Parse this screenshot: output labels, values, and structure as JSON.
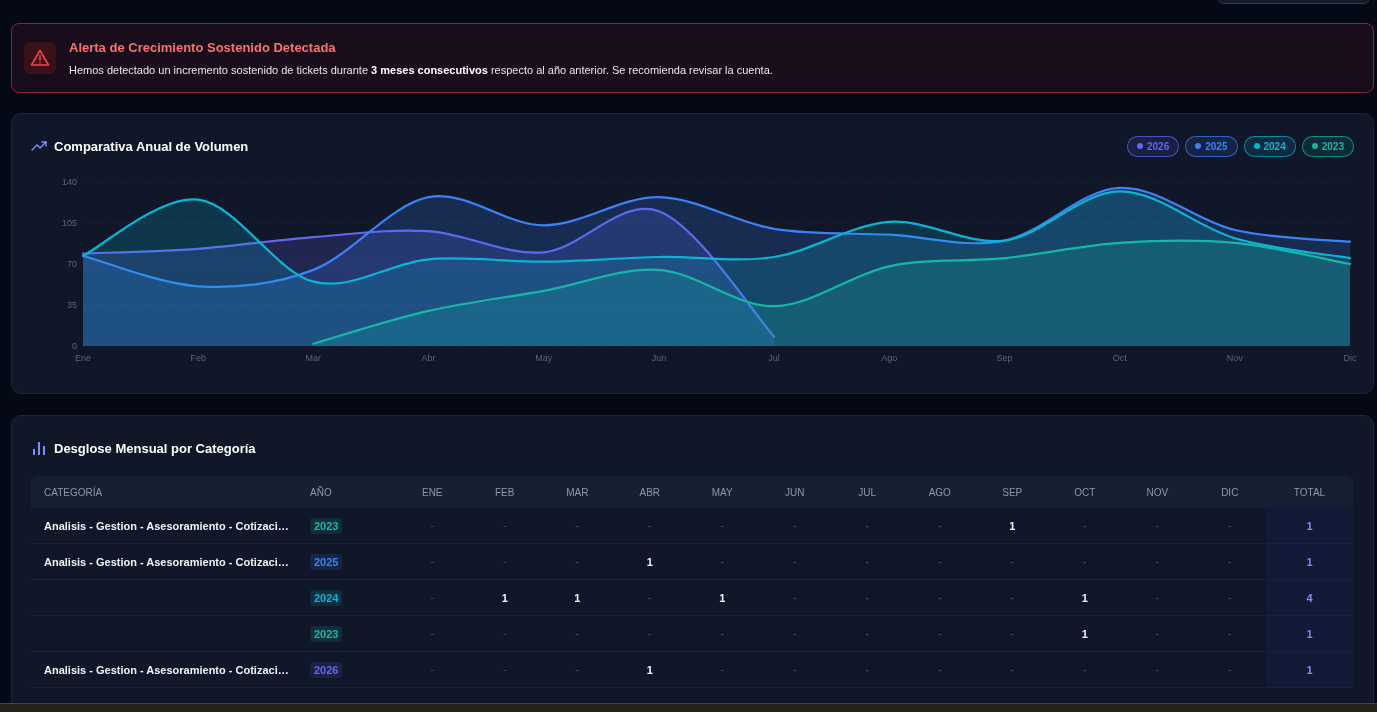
{
  "alert": {
    "title": "Alerta de Crecimiento Sostenido Detectada",
    "message": "Hemos detectado un incremento sostenido de tickets durante **3 meses consecutivos** respecto al año anterior. Se recomienda revisar la cuenta."
  },
  "volume_chart": {
    "title": "Comparativa Anual de Volumen",
    "chart_data": {
      "type": "area",
      "categories": [
        "Ene",
        "Feb",
        "Mar",
        "Abr",
        "May",
        "Jun",
        "Jul",
        "Ago",
        "Sep",
        "Oct",
        "Nov",
        "Dic"
      ],
      "series": [
        {
          "name": "2026",
          "color": "#6366f1",
          "values": [
            79,
            83,
            93,
            98,
            80,
            115,
            8,
            null,
            null,
            null,
            null,
            null
          ]
        },
        {
          "name": "2025",
          "color": "#3b82f6",
          "values": [
            77,
            51,
            65,
            127,
            103,
            127,
            100,
            95,
            90,
            135,
            99,
            89
          ]
        },
        {
          "name": "2024",
          "color": "#06b6d4",
          "values": [
            77,
            125,
            55,
            74,
            72,
            76,
            76,
            106,
            90,
            132,
            92,
            75
          ]
        },
        {
          "name": "2023",
          "color": "#14b8a6",
          "values": [
            null,
            null,
            2,
            30,
            47,
            65,
            34,
            68,
            75,
            88,
            88,
            70
          ]
        }
      ],
      "ylim": [
        0,
        140
      ],
      "yticks": [
        0,
        35,
        70,
        105,
        140
      ]
    }
  },
  "breakdown": {
    "title": "Desglose Mensual por Categoría",
    "table": {
      "columns": [
        "CATEGORÍA",
        "AÑO",
        "ENE",
        "FEB",
        "MAR",
        "ABR",
        "MAY",
        "JUN",
        "JUL",
        "AGO",
        "SEP",
        "OCT",
        "NOV",
        "DIC",
        "TOTAL"
      ],
      "rows": [
        {
          "category": "Analisis - Gestion - Asesoramiento - Cotizaci…",
          "year": "2023",
          "color": "#14b8a6",
          "months": [
            "-",
            "-",
            "-",
            "-",
            "-",
            "-",
            "-",
            "-",
            "1",
            "-",
            "-",
            "-"
          ],
          "total": "1"
        },
        {
          "category": "Analisis - Gestion - Asesoramiento - Cotizaci…",
          "year": "2025",
          "color": "#3b82f6",
          "months": [
            "-",
            "-",
            "-",
            "1",
            "-",
            "-",
            "-",
            "-",
            "-",
            "-",
            "-",
            "-"
          ],
          "total": "1"
        },
        {
          "year": "2024",
          "color": "#06b6d4",
          "months": [
            "-",
            "1",
            "1",
            "-",
            "1",
            "-",
            "-",
            "-",
            "-",
            "1",
            "-",
            "-"
          ],
          "total": "4"
        },
        {
          "year": "2023",
          "color": "#14b8a6",
          "months": [
            "-",
            "-",
            "-",
            "-",
            "-",
            "-",
            "-",
            "-",
            "-",
            "1",
            "-",
            "-"
          ],
          "total": "1"
        },
        {
          "category": "Analisis - Gestion - Asesoramiento - Cotizaci…",
          "year": "2026",
          "color": "#6366f1",
          "months": [
            "-",
            "-",
            "-",
            "1",
            "-",
            "-",
            "-",
            "-",
            "-",
            "-",
            "-",
            "-"
          ],
          "total": "1"
        }
      ]
    }
  }
}
